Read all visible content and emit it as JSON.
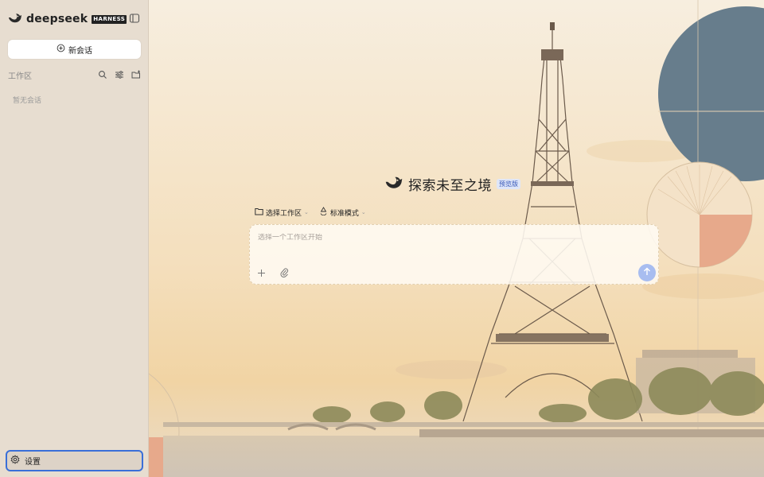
{
  "sidebar": {
    "brand": {
      "word": "deepseek",
      "tag": "HARNESS"
    },
    "new_chat_label": "新会话",
    "workspace_title": "工作区",
    "empty_note": "暂无会话",
    "settings_label": "设置"
  },
  "main": {
    "hero_title": "探索未至之境",
    "preview_badge": "预览版",
    "workspace_selector": "选择工作区",
    "mode_selector": "标准模式",
    "composer_placeholder": "选择一个工作区开始"
  },
  "colors": {
    "accent": "#3a6fd8",
    "send_button": "#a8bdf0",
    "sidebar_bg": "#e7ddd0",
    "badge_bg": "#dfe6f8"
  },
  "icons": [
    "whale-logo-icon",
    "sidebar-toggle-icon",
    "plus-circle-icon",
    "search-icon",
    "filter-icon",
    "new-folder-icon",
    "gear-icon",
    "folder-icon",
    "mode-cycle-icon",
    "chevron-down-icon",
    "plus-icon",
    "attach-icon",
    "arrow-up-icon"
  ]
}
